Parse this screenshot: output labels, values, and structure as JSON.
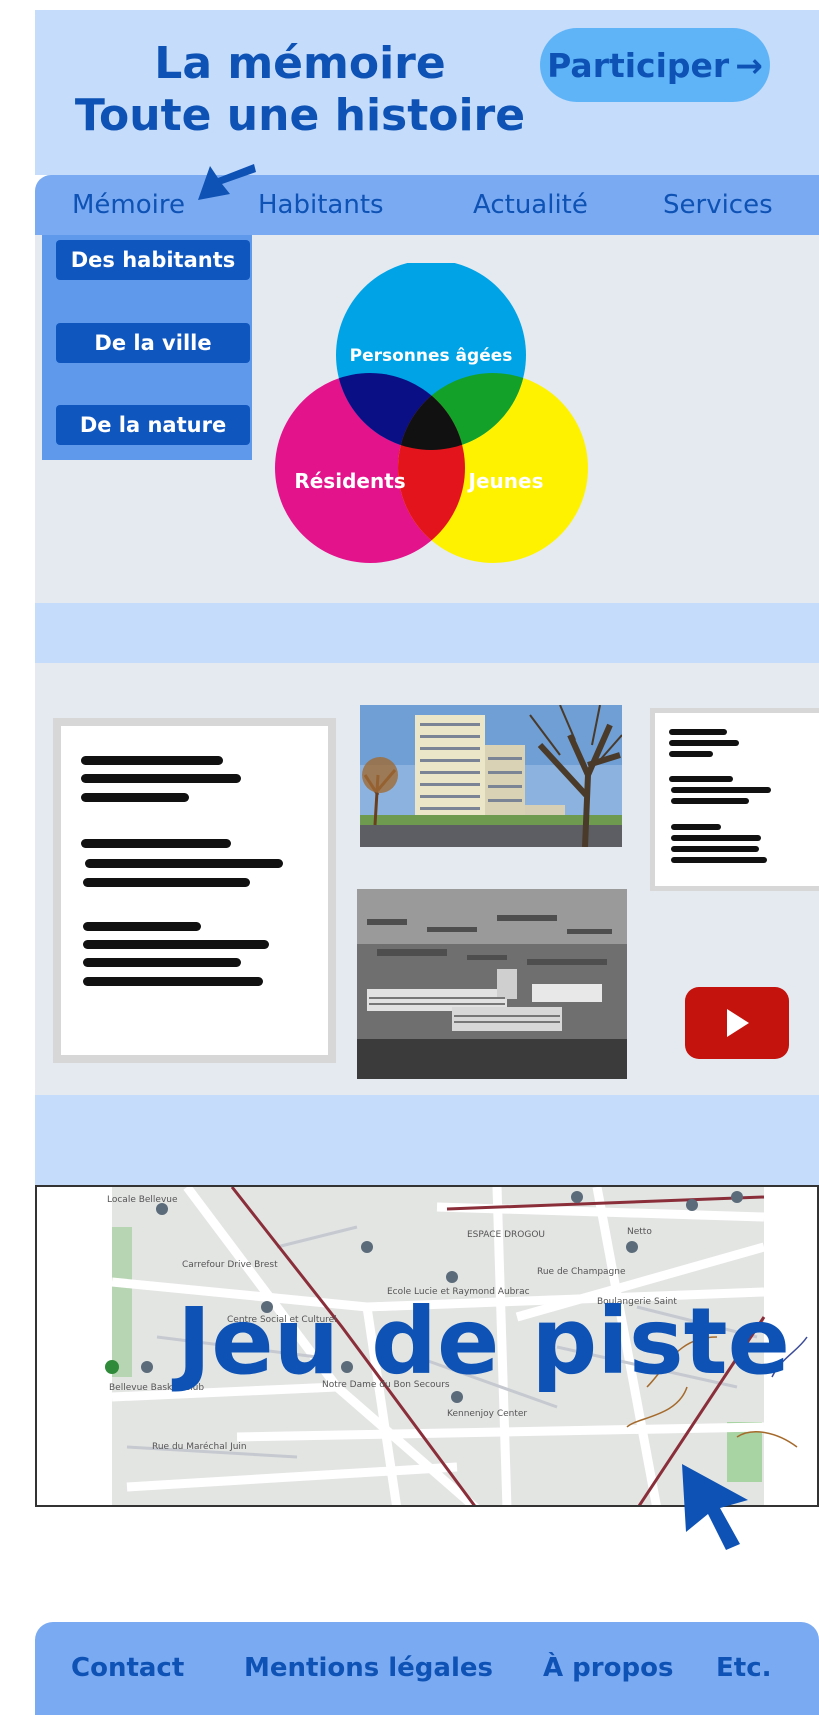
{
  "header": {
    "title_line1": "La mémoire",
    "title_line2": "Toute une histoire",
    "participate_label": "Participer",
    "participate_arrow": "→"
  },
  "nav": {
    "items": [
      "Mémoire",
      "Habitants",
      "Actualité",
      "Services"
    ]
  },
  "submenu": {
    "items": [
      "Des habitants",
      "De la ville",
      "De la nature"
    ]
  },
  "venn": {
    "top": "Personnes âgées",
    "left": "Résidents",
    "right": "Jeunes"
  },
  "map": {
    "title": "Jeu de piste",
    "labels": [
      "Locale Bellevue",
      "Carrefour Drive Brest",
      "Centre Social et Culturel",
      "ESPACE DROGOU",
      "Bellevue Basket Club",
      "Notre Dame du Bon Secours",
      "Ecole Lucie et Raymond Aubrac",
      "Netto",
      "Kennenjoy Center",
      "Rue de Champagne",
      "Rue du Maréchal Juin",
      "Boulangerie Saint"
    ]
  },
  "footer": {
    "items": [
      "Contact",
      "Mentions légales",
      "À propos",
      "Etc."
    ]
  },
  "colors": {
    "accent": "#0d52b4",
    "header_bg": "#c5dcfb",
    "nav_bg": "#7aaaf1",
    "panel_bg": "#e4eaf0",
    "venn_cyan": "#00a3e6",
    "venn_magenta": "#e3138c",
    "venn_yellow": "#fff200"
  },
  "icons": [
    "arrow-right-icon",
    "pointer-arrow-icon",
    "youtube-play-icon",
    "cursor-icon",
    "map-pin-icon"
  ]
}
